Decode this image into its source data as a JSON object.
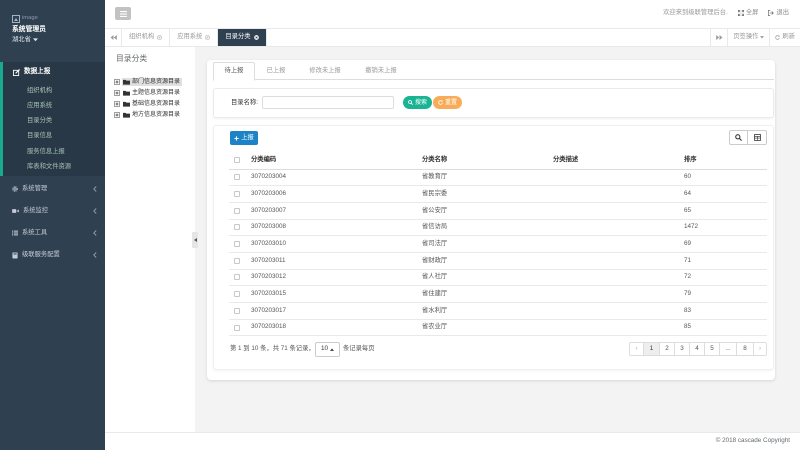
{
  "colors": {
    "sidebar_bg": "#2f4050",
    "sidebar_active_bg": "#293846",
    "active_border": "#19aa8d",
    "success_green": "#1ab394",
    "warning_orange": "#f8ac59",
    "primary_blue": "#1c84c6",
    "content_bg": "#f3f3f4"
  },
  "sidebar": {
    "avatar_alt": "image",
    "user_name": "系统管理员",
    "user_region": "湖北省",
    "menu": [
      {
        "label": "数据上报",
        "icon": "edit-icon",
        "expanded": true,
        "children": [
          "组织机构",
          "应用系统",
          "目录分类",
          "目录信息",
          "服务信息上报",
          "库表和文件资源"
        ]
      },
      {
        "label": "系统管理",
        "icon": "gear-icon"
      },
      {
        "label": "系统监控",
        "icon": "video-icon"
      },
      {
        "label": "系统工具",
        "icon": "list-icon"
      },
      {
        "label": "级联服务配置",
        "icon": "book-icon"
      }
    ]
  },
  "topbar": {
    "toggle_icon": "hamburger-icon",
    "welcome": "欢迎来到级联管理后台.",
    "fullscreen": "全屏",
    "logout": "退出"
  },
  "page_tabs": {
    "items": [
      {
        "label": "组织机构",
        "active": false
      },
      {
        "label": "应用系统",
        "active": false
      },
      {
        "label": "目录分类",
        "active": true
      }
    ],
    "tab_actions": "页签操作",
    "refresh": "刷新"
  },
  "tree": {
    "title": "目录分类",
    "nodes": [
      {
        "label": "部门信息资源目录",
        "selected": true
      },
      {
        "label": "主题信息资源目录",
        "selected": false
      },
      {
        "label": "基础信息资源目录",
        "selected": false
      },
      {
        "label": "地方信息资源目录",
        "selected": false
      }
    ]
  },
  "status_tabs": {
    "items": [
      "待上报",
      "已上报",
      "修改未上报",
      "撤销未上报"
    ],
    "active_index": 0
  },
  "search_form": {
    "label": "目录名称:",
    "value": "",
    "placeholder": "",
    "search_label": "搜索",
    "reset_label": "重置"
  },
  "toolbar": {
    "report_label": "上报"
  },
  "table": {
    "headers": [
      "分类编码",
      "分类名称",
      "分类描述",
      "排序"
    ],
    "rows": [
      {
        "code": "3070203004",
        "name": "省教育厅",
        "desc": "",
        "sort": "60"
      },
      {
        "code": "3070203006",
        "name": "省民宗委",
        "desc": "",
        "sort": "64"
      },
      {
        "code": "3070203007",
        "name": "省公安厅",
        "desc": "",
        "sort": "65"
      },
      {
        "code": "3070203008",
        "name": "省信访局",
        "desc": "",
        "sort": "1472"
      },
      {
        "code": "3070203010",
        "name": "省司法厅",
        "desc": "",
        "sort": "69"
      },
      {
        "code": "3070203011",
        "name": "省财政厅",
        "desc": "",
        "sort": "71"
      },
      {
        "code": "3070203012",
        "name": "省人社厅",
        "desc": "",
        "sort": "72"
      },
      {
        "code": "3070203015",
        "name": "省住建厅",
        "desc": "",
        "sort": "79"
      },
      {
        "code": "3070203017",
        "name": "省水利厅",
        "desc": "",
        "sort": "83"
      },
      {
        "code": "3070203018",
        "name": "省农业厅",
        "desc": "",
        "sort": "85"
      }
    ]
  },
  "pagination": {
    "summary": "第 1 到 10 条，共 71 条记录，",
    "page_size": "10",
    "page_size_suffix": "条记录每页",
    "prev": "‹",
    "next": "›",
    "pages": [
      "1",
      "2",
      "3",
      "4",
      "5",
      "...",
      "8"
    ],
    "current_index": 0
  },
  "footer": {
    "copyright": "© 2018 cascade Copyright"
  }
}
